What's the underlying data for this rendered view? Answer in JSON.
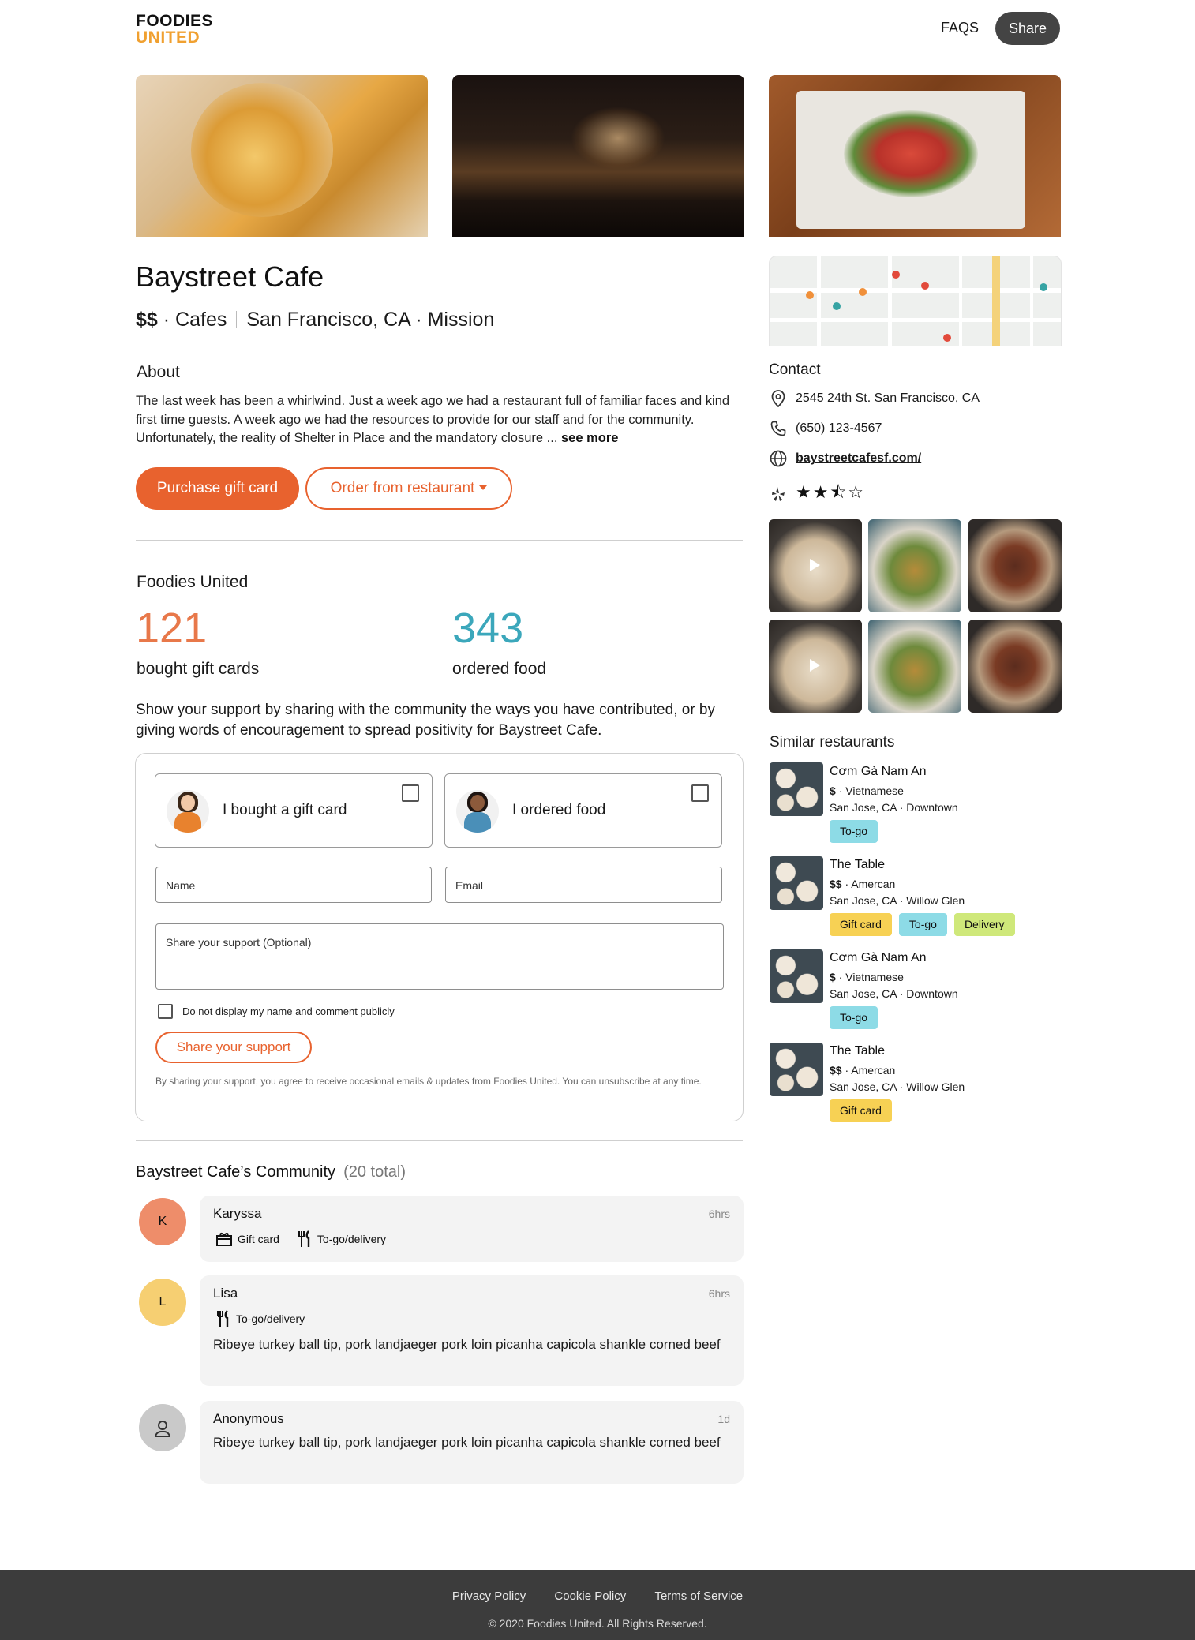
{
  "header": {
    "logo_line1": "FOODIES",
    "logo_line2": "UNITED",
    "faqs": "FAQS",
    "share": "Share"
  },
  "restaurant": {
    "name": "Baystreet Cafe",
    "price": "$$",
    "category": "Cafes",
    "location": "San Francisco, CA · Mission"
  },
  "about": {
    "heading": "About",
    "text": "The last week has been a whirlwind. Just a week ago we had a restaurant full of familiar faces and kind first time guests. A week ago we had the resources to provide for our staff and for the community. Unfortunately, the reality of Shelter in Place and the mandatory closure ... ",
    "see_more": "see more"
  },
  "actions": {
    "purchase_gift_card": "Purchase gift card",
    "order_from_restaurant": "Order from restaurant"
  },
  "stats": {
    "heading": "Foodies United",
    "gift_cards_count": "121",
    "gift_cards_label": "bought gift cards",
    "ordered_count": "343",
    "ordered_label": "ordered food",
    "support_text": "Show your support by sharing with the community the ways you have contributed, or by giving words of encouragement to spread positivity for Baystreet Cafe."
  },
  "form": {
    "option_gift": "I bought a gift card",
    "option_food": "I ordered food",
    "name_placeholder": "Name",
    "email_placeholder": "Email",
    "share_placeholder": "Share your support (Optional)",
    "anonymous_label": "Do not display my name and comment publicly",
    "submit": "Share your support",
    "fine_print": "By sharing your support, you agree to receive occasional emails & updates from Foodies United. You can unsubscribe at any time."
  },
  "community": {
    "heading": "Baystreet Cafe’s Community",
    "total": "(20 total)",
    "posts": [
      {
        "initial": "K",
        "name": "Karyssa",
        "time": "6hrs",
        "tags": [
          "Gift card",
          "To-go/delivery"
        ],
        "text": ""
      },
      {
        "initial": "L",
        "name": "Lisa",
        "time": "6hrs",
        "tags": [
          "To-go/delivery"
        ],
        "text": "Ribeye turkey ball tip, pork landjaeger pork loin picanha capicola shankle corned beef"
      },
      {
        "initial": "",
        "name": "Anonymous",
        "time": "1d",
        "tags": [],
        "text": "Ribeye turkey ball tip, pork landjaeger pork loin picanha capicola shankle corned beef"
      }
    ]
  },
  "contact": {
    "heading": "Contact",
    "address": "2545 24th St. San Francisco, CA",
    "phone": "(650) 123-4567",
    "website": "baystreetcafesf.com/",
    "rating_stars": "★★⯪☆",
    "rating_value": 2.5
  },
  "similar": {
    "heading": "Similar restaurants",
    "items": [
      {
        "name": "Cơm Gà Nam An",
        "price": "$",
        "category": " · Vietnamese",
        "location": "San Jose, CA · Downtown",
        "badges": [
          "To-go"
        ]
      },
      {
        "name": "The Table",
        "price": "$$",
        "category": " · Amercan",
        "location": "San Jose, CA · Willow Glen",
        "badges": [
          "Gift card",
          "To-go",
          "Delivery"
        ]
      },
      {
        "name": "Cơm Gà Nam An",
        "price": "$",
        "category": " · Vietnamese",
        "location": "San Jose, CA · Downtown",
        "badges": [
          "To-go"
        ]
      },
      {
        "name": "The Table",
        "price": "$$",
        "category": " · Amercan",
        "location": "San Jose, CA · Willow Glen",
        "badges": [
          "Gift card"
        ]
      }
    ]
  },
  "footer": {
    "privacy": "Privacy Policy",
    "cookie": "Cookie Policy",
    "terms": "Terms of Service",
    "copyright": "© 2020 Foodies United. All Rights Reserved."
  },
  "colors": {
    "accent": "#e8622e",
    "gift_count": "#e8784a",
    "ordered_count": "#3ba7bb",
    "badge_togo": "#8ddbe6",
    "badge_gift": "#f7d154",
    "badge_delivery": "#cfe87a"
  }
}
